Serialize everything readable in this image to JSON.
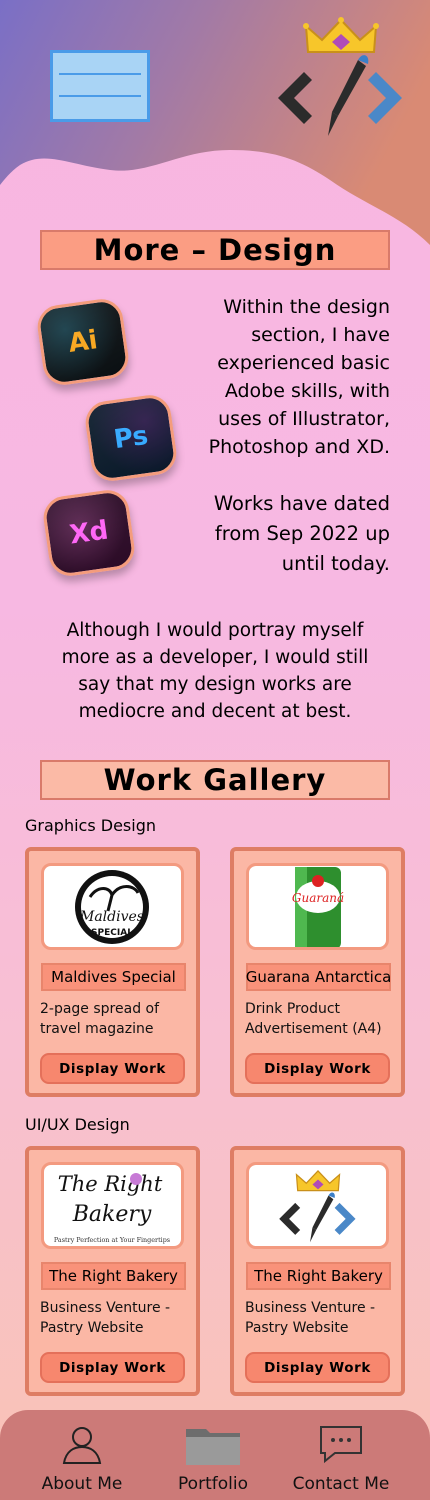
{
  "header": {
    "menu_icon": "hamburger-menu-icon",
    "logo_icon": "crown-code-brush-logo"
  },
  "design_section": {
    "title": "More – Design",
    "apps": [
      {
        "icon": "adobe-illustrator-icon",
        "label": "Ai"
      },
      {
        "icon": "adobe-photoshop-icon",
        "label": "Ps"
      },
      {
        "icon": "adobe-xd-icon",
        "label": "Xd"
      }
    ],
    "paragraph1": "Within the design section, I have experienced basic Adobe skills, with uses of Illustrator, Photoshop and XD.",
    "paragraph2": "Works have dated from Sep 2022 up until today.",
    "paragraph3": "Although I would portray myself more as a developer, I would still say that my design works are mediocre and decent at best."
  },
  "gallery": {
    "title": "Work Gallery",
    "graphics_label": "Graphics Design",
    "uiux_label": "UI/UX Design",
    "graphics": [
      {
        "name": "Maldives Special",
        "desc": "2-page spread of travel magazine",
        "button": "Display Work",
        "logo_line1": "Maldives",
        "logo_line2": "SPECIAL"
      },
      {
        "name": "Guarana Antarctica",
        "desc": "Drink Product Advertisement (A4)",
        "button": "Display Work",
        "can_text": "Guaraná"
      }
    ],
    "uiux": [
      {
        "name": "The Right Bakery",
        "desc": "Business Venture - Pastry Website",
        "button": "Display Work",
        "logo_line1": "The Right",
        "logo_line2": "Bakery",
        "tagline": "Pastry Perfection at Your Fingertips"
      },
      {
        "name": "The Right Bakery",
        "desc": "Business Venture - Pastry Website",
        "button": "Display Work"
      }
    ]
  },
  "nav": {
    "items": [
      {
        "label": "About Me",
        "icon": "user-icon"
      },
      {
        "label": "Portfolio",
        "icon": "folder-icon"
      },
      {
        "label": "Contact Me",
        "icon": "chat-icon"
      }
    ]
  },
  "colors": {
    "accent": "#fb9d83",
    "card_border": "#de7d64",
    "nav_bg": "#cc7a78",
    "header_top": "#7b6fc4"
  }
}
